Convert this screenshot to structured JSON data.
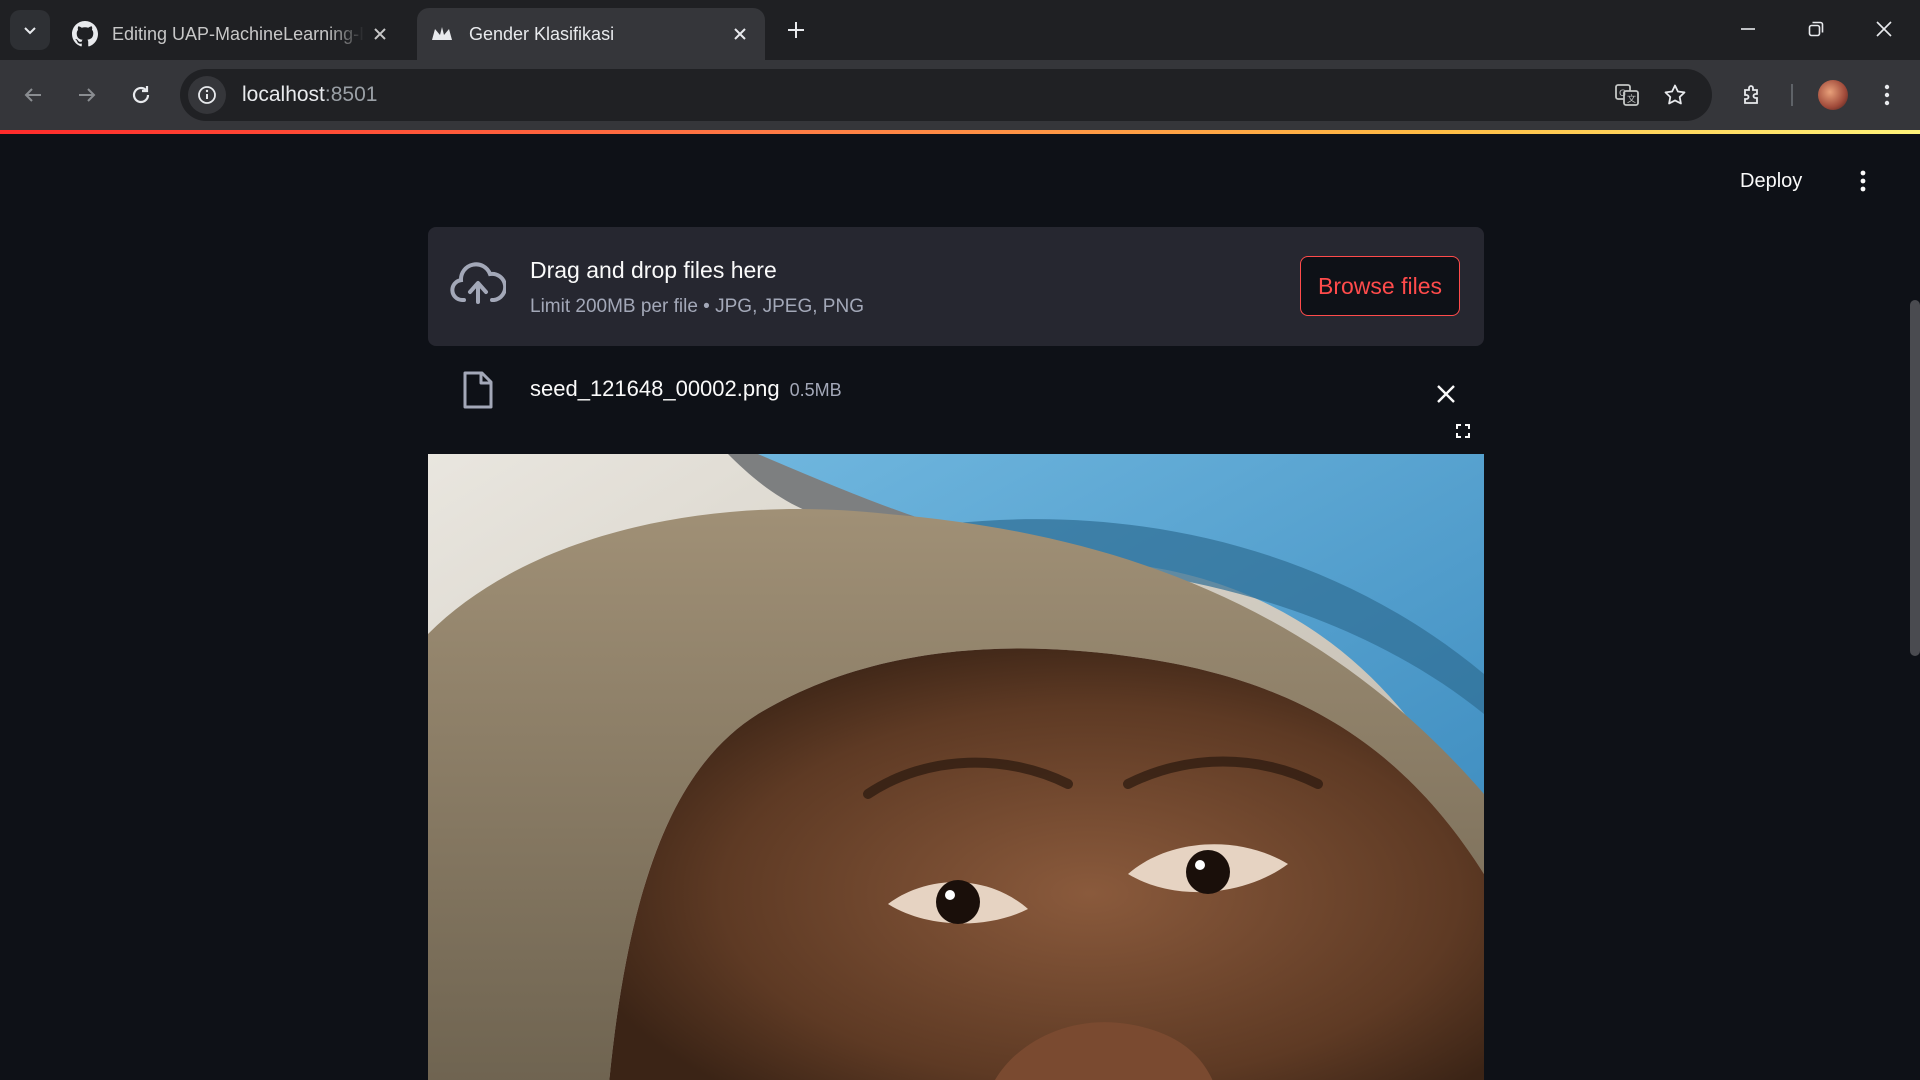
{
  "browser": {
    "tabs": [
      {
        "title": "Editing UAP-MachineLearning-I",
        "favicon": "github-icon",
        "active": false
      },
      {
        "title": "Gender Klasifikasi",
        "favicon": "streamlit-icon",
        "active": true
      }
    ],
    "address": {
      "host": "localhost",
      "port": ":8501"
    }
  },
  "app": {
    "deploy_label": "Deploy",
    "uploader": {
      "title": "Drag and drop files here",
      "limit": "Limit 200MB per file • JPG, JPEG, PNG",
      "browse_label": "Browse files"
    },
    "file": {
      "name": "seed_121648_00002.png",
      "size": "0.5MB"
    }
  },
  "colors": {
    "accent": "#ff4b4b",
    "background": "#0e1117",
    "dropzone": "#262730"
  }
}
